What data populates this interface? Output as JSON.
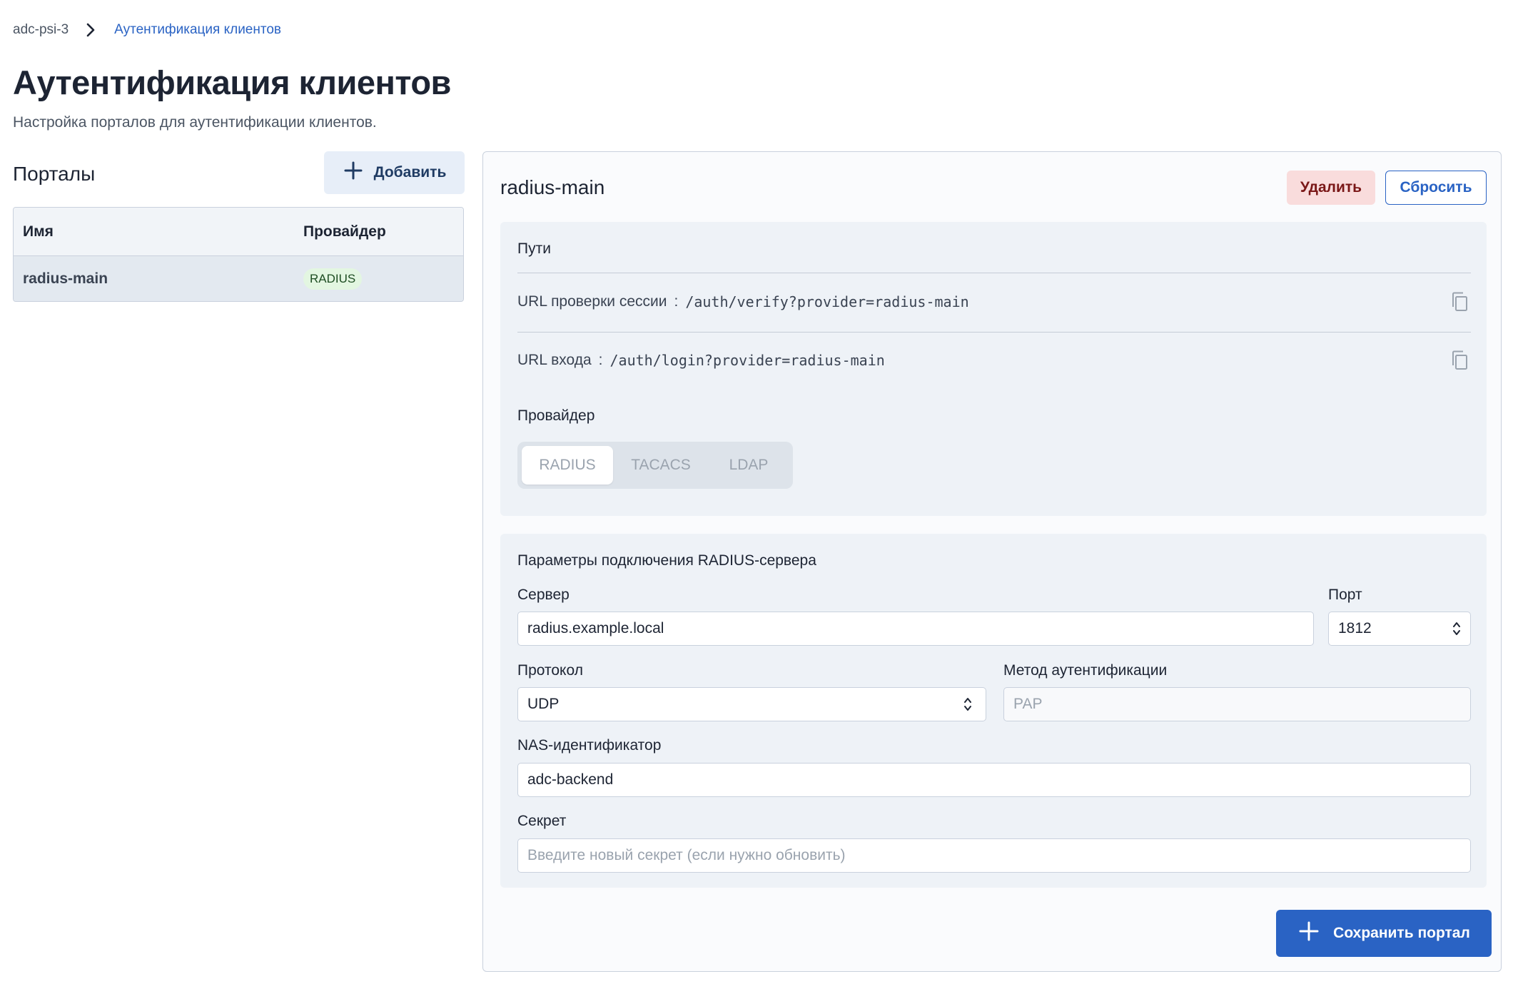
{
  "breadcrumb": {
    "root": "adc-psi-3",
    "current": "Аутентификация клиентов"
  },
  "page": {
    "title": "Аутентификация клиентов",
    "subtitle": "Настройка порталов для аутентификации клиентов."
  },
  "portals": {
    "title": "Порталы",
    "add_label": "Добавить",
    "columns": [
      "Имя",
      "Провайдер"
    ],
    "rows": [
      {
        "name": "radius-main",
        "provider": "RADIUS"
      }
    ]
  },
  "detail": {
    "title": "radius-main",
    "delete_label": "Удалить",
    "reset_label": "Сбросить",
    "paths": {
      "heading": "Пути",
      "items": [
        {
          "label": "URL проверки сессии",
          "value": "/auth/verify?provider=radius-main"
        },
        {
          "label": "URL входа",
          "value": "/auth/login?provider=radius-main"
        }
      ]
    },
    "provider": {
      "heading": "Провайдер",
      "options": [
        "RADIUS",
        "TACACS",
        "LDAP"
      ],
      "selected": "RADIUS"
    },
    "connection": {
      "heading": "Параметры подключения RADIUS-сервера",
      "server_label": "Сервер",
      "server_value": "radius.example.local",
      "port_label": "Порт",
      "port_value": "1812",
      "protocol_label": "Протокол",
      "protocol_value": "UDP",
      "auth_method_label": "Метод аутентификации",
      "auth_method_placeholder": "PAP",
      "nas_label": "NAS-идентификатор",
      "nas_value": "adc-backend",
      "secret_label": "Секрет",
      "secret_placeholder": "Введите новый секрет (если нужно обновить)"
    },
    "save_label": "Сохранить портал"
  },
  "colors": {
    "accent": "#2a63c4",
    "danger_bg": "#f9dcdc",
    "badge_bg": "#e3f6e1"
  },
  "icons": {
    "breadcrumb_sep": "chevron-right-icon",
    "add": "plus-icon",
    "copy": "copy-icon",
    "stepper": "chevron-up-down-icon"
  }
}
